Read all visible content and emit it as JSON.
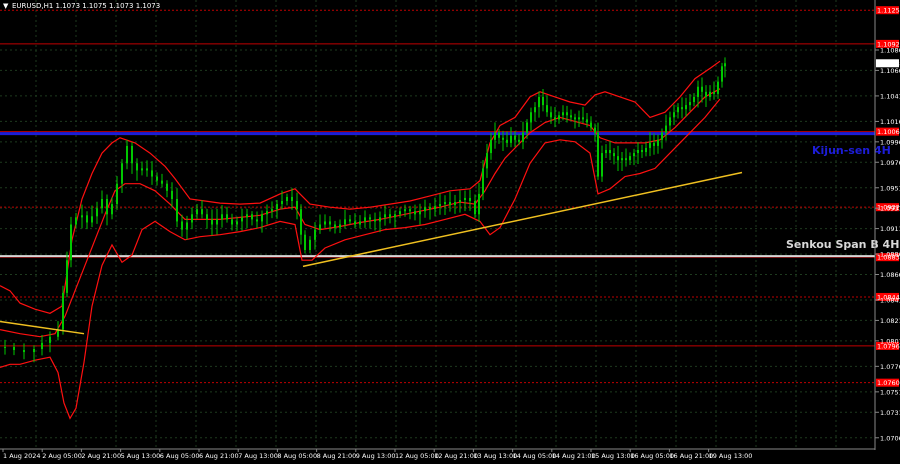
{
  "header": {
    "symbol_line": "EURUSD,H1  1.1073 1.1075 1.1073 1.1073",
    "arrow_glyph": "▼"
  },
  "labels": {
    "kijun": "Kijun-sen 4H",
    "senkou": "Senkou Span B 4H"
  },
  "colors": {
    "background": "#000000",
    "grid": "#1e3a1e",
    "candles": "#00c800",
    "bands": "#ff1010",
    "levels": "#c00000",
    "trendline": "#f0c020",
    "kijun": "#1d1dd8",
    "senkou": "#d8d8d8",
    "kijun_text": "#1d1dd8",
    "senkou_text": "#d8d8d8",
    "axis_text": "#ffffff",
    "highlight_box": "#ff0000"
  },
  "chart_data": {
    "type": "line",
    "title": "EURUSD,H1  1.1073 1.1075 1.1073 1.1073",
    "y_range": [
      1.0695,
      1.1135
    ],
    "price_ticks": [
      "1.1086",
      "1.1066",
      "1.1041",
      "1.1016",
      "1.0996",
      "1.0976",
      "1.0951",
      "1.0931",
      "1.0911",
      "1.0886",
      "1.0866",
      "1.0841",
      "1.0821",
      "1.0801",
      "1.0776",
      "1.0751",
      "1.0731",
      "1.0706"
    ],
    "time_ticks": [
      "1 Aug 2024",
      "2 Aug 05:00",
      "2 Aug 21:00",
      "5 Aug 13:00",
      "6 Aug 05:00",
      "6 Aug 21:00",
      "7 Aug 13:00",
      "8 Aug 05:00",
      "8 Aug 21:00",
      "9 Aug 13:00",
      "12 Aug 05:00",
      "12 Aug 21:00",
      "13 Aug 13:00",
      "14 Aug 05:00",
      "14 Aug 21:00",
      "15 Aug 13:00",
      "16 Aug 05:00",
      "16 Aug 21:00",
      "19 Aug 13:00"
    ],
    "levels": [
      {
        "value": 1.1125,
        "label": "1.1125",
        "style": "dotted"
      },
      {
        "value": 1.1092,
        "label": "1.1092",
        "style": "solid"
      },
      {
        "value": 1.1006,
        "label": "1.1006",
        "style": "solid"
      },
      {
        "value": 1.0932,
        "label": "1.0932",
        "style": "dotted"
      },
      {
        "value": 1.0883,
        "label": "1.0883",
        "style": "solid"
      },
      {
        "value": 1.0844,
        "label": "1.0844",
        "style": "dotted"
      },
      {
        "value": 1.0796,
        "label": "1.0796",
        "style": "solid"
      },
      {
        "value": 1.076,
        "label": "1.0760",
        "style": "dotted"
      }
    ],
    "kijun_sen": 1.1004,
    "senkou_span_b": 1.0884,
    "current_price": "1.1073",
    "trendlines": [
      {
        "x1": 0,
        "y1": 1.082,
        "x2": 84,
        "y2": 1.0808
      },
      {
        "x1": 303,
        "y1": 1.0874,
        "x2": 742,
        "y2": 1.0966
      }
    ],
    "price_series": [
      [
        5,
        1.0795
      ],
      [
        14,
        1.0792
      ],
      [
        24,
        1.079
      ],
      [
        34,
        1.0793
      ],
      [
        42,
        1.0799
      ],
      [
        50,
        1.0805
      ],
      [
        58,
        1.0812
      ],
      [
        63,
        1.0848
      ],
      [
        67,
        1.088
      ],
      [
        71,
        1.0915
      ],
      [
        76,
        1.0922
      ],
      [
        82,
        1.0924
      ],
      [
        87,
        1.0917
      ],
      [
        92,
        1.0923
      ],
      [
        97,
        1.0931
      ],
      [
        102,
        1.094
      ],
      [
        107,
        1.0925
      ],
      [
        112,
        1.0935
      ],
      [
        117,
        1.0955
      ],
      [
        122,
        1.0975
      ],
      [
        127,
        1.0992
      ],
      [
        132,
        1.0975
      ],
      [
        137,
        1.0968
      ],
      [
        142,
        1.097
      ],
      [
        147,
        1.0968
      ],
      [
        152,
        1.0962
      ],
      [
        157,
        1.0958
      ],
      [
        162,
        1.0955
      ],
      [
        167,
        1.0948
      ],
      [
        172,
        1.094
      ],
      [
        177,
        1.0918
      ],
      [
        182,
        1.091
      ],
      [
        187,
        1.0917
      ],
      [
        192,
        1.0925
      ],
      [
        197,
        1.093
      ],
      [
        202,
        1.0925
      ],
      [
        207,
        1.092
      ],
      [
        212,
        1.0915
      ],
      [
        217,
        1.092
      ],
      [
        222,
        1.0925
      ],
      [
        227,
        1.092
      ],
      [
        232,
        1.0915
      ],
      [
        237,
        1.0918
      ],
      [
        242,
        1.0922
      ],
      [
        247,
        1.0925
      ],
      [
        252,
        1.092
      ],
      [
        257,
        1.0918
      ],
      [
        262,
        1.0925
      ],
      [
        267,
        1.0928
      ],
      [
        272,
        1.093
      ],
      [
        277,
        1.0935
      ],
      [
        282,
        1.0938
      ],
      [
        287,
        1.0942
      ],
      [
        292,
        1.0938
      ],
      [
        297,
        1.093
      ],
      [
        301,
        1.0905
      ],
      [
        305,
        1.089
      ],
      [
        310,
        1.09
      ],
      [
        315,
        1.091
      ],
      [
        320,
        1.0915
      ],
      [
        325,
        1.0918
      ],
      [
        330,
        1.0915
      ],
      [
        335,
        1.0912
      ],
      [
        340,
        1.0915
      ],
      [
        345,
        1.092
      ],
      [
        350,
        1.0918
      ],
      [
        355,
        1.0915
      ],
      [
        360,
        1.0918
      ],
      [
        365,
        1.0922
      ],
      [
        370,
        1.092
      ],
      [
        375,
        1.0918
      ],
      [
        380,
        1.0922
      ],
      [
        385,
        1.0925
      ],
      [
        390,
        1.0922
      ],
      [
        395,
        1.0925
      ],
      [
        400,
        1.0928
      ],
      [
        405,
        1.093
      ],
      [
        410,
        1.0928
      ],
      [
        415,
        1.0925
      ],
      [
        420,
        1.0928
      ],
      [
        425,
        1.0932
      ],
      [
        430,
        1.093
      ],
      [
        435,
        1.0933
      ],
      [
        440,
        1.0935
      ],
      [
        445,
        1.0937
      ],
      [
        450,
        1.0934
      ],
      [
        455,
        1.0937
      ],
      [
        460,
        1.0939
      ],
      [
        465,
        1.0941
      ],
      [
        470,
        1.0938
      ],
      [
        475,
        1.0925
      ],
      [
        479,
        1.0945
      ],
      [
        483,
        1.097
      ],
      [
        487,
        1.0985
      ],
      [
        491,
        1.0998
      ],
      [
        495,
        1.1005
      ],
      [
        499,
        1.1
      ],
      [
        503,
        1.0998
      ],
      [
        507,
        1.0995
      ],
      [
        511,
        1.1002
      ],
      [
        515,
        1.0998
      ],
      [
        519,
        1.0996
      ],
      [
        523,
        1.1005
      ],
      [
        527,
        1.1015
      ],
      [
        531,
        1.1025
      ],
      [
        535,
        1.103
      ],
      [
        539,
        1.104
      ],
      [
        543,
        1.1032
      ],
      [
        547,
        1.1025
      ],
      [
        551,
        1.102
      ],
      [
        555,
        1.1018
      ],
      [
        559,
        1.1022
      ],
      [
        563,
        1.1025
      ],
      [
        567,
        1.1022
      ],
      [
        571,
        1.102
      ],
      [
        575,
        1.1018
      ],
      [
        579,
        1.102
      ],
      [
        583,
        1.1018
      ],
      [
        587,
        1.1015
      ],
      [
        591,
        1.101
      ],
      [
        595,
        1.1005
      ],
      [
        598,
        1.0962
      ],
      [
        602,
        1.0985
      ],
      [
        606,
        1.0988
      ],
      [
        610,
        1.0985
      ],
      [
        614,
        1.0982
      ],
      [
        618,
        1.0978
      ],
      [
        622,
        1.098
      ],
      [
        626,
        1.0978
      ],
      [
        630,
        1.0982
      ],
      [
        634,
        1.0985
      ],
      [
        638,
        1.0988
      ],
      [
        642,
        1.0986
      ],
      [
        646,
        1.099
      ],
      [
        650,
        1.0995
      ],
      [
        654,
        1.0992
      ],
      [
        658,
        1.0998
      ],
      [
        662,
        1.1005
      ],
      [
        666,
        1.1012
      ],
      [
        670,
        1.102
      ],
      [
        674,
        1.1025
      ],
      [
        678,
        1.103
      ],
      [
        682,
        1.1028
      ],
      [
        686,
        1.1032
      ],
      [
        690,
        1.1035
      ],
      [
        694,
        1.104
      ],
      [
        698,
        1.105
      ],
      [
        702,
        1.1045
      ],
      [
        706,
        1.104
      ],
      [
        710,
        1.1045
      ],
      [
        714,
        1.1043
      ],
      [
        718,
        1.1055
      ],
      [
        722,
        1.107
      ],
      [
        725,
        1.1073
      ]
    ],
    "bands": {
      "upper": [
        [
          0,
          1.0855
        ],
        [
          10,
          1.085
        ],
        [
          20,
          1.0838
        ],
        [
          35,
          1.0832
        ],
        [
          50,
          1.0828
        ],
        [
          62,
          1.0835
        ],
        [
          72,
          1.09
        ],
        [
          82,
          1.094
        ],
        [
          92,
          1.0965
        ],
        [
          102,
          1.0985
        ],
        [
          112,
          1.0995
        ],
        [
          120,
          1.1
        ],
        [
          135,
          1.0995
        ],
        [
          150,
          1.0985
        ],
        [
          165,
          1.0972
        ],
        [
          175,
          1.096
        ],
        [
          190,
          1.094
        ],
        [
          205,
          1.0938
        ],
        [
          220,
          1.0936
        ],
        [
          240,
          1.0935
        ],
        [
          260,
          1.0936
        ],
        [
          280,
          1.0945
        ],
        [
          295,
          1.095
        ],
        [
          300,
          1.0945
        ],
        [
          310,
          1.0935
        ],
        [
          330,
          1.0932
        ],
        [
          350,
          1.093
        ],
        [
          370,
          1.0932
        ],
        [
          390,
          1.0935
        ],
        [
          410,
          1.0938
        ],
        [
          430,
          1.0943
        ],
        [
          450,
          1.0948
        ],
        [
          470,
          1.095
        ],
        [
          480,
          1.0958
        ],
        [
          490,
          1.0995
        ],
        [
          500,
          1.1012
        ],
        [
          515,
          1.102
        ],
        [
          530,
          1.104
        ],
        [
          540,
          1.1045
        ],
        [
          555,
          1.104
        ],
        [
          570,
          1.1035
        ],
        [
          585,
          1.1032
        ],
        [
          595,
          1.1042
        ],
        [
          605,
          1.1045
        ],
        [
          620,
          1.104
        ],
        [
          635,
          1.1035
        ],
        [
          650,
          1.102
        ],
        [
          665,
          1.1025
        ],
        [
          680,
          1.104
        ],
        [
          695,
          1.1058
        ],
        [
          710,
          1.1068
        ],
        [
          720,
          1.1075
        ]
      ],
      "lower": [
        [
          0,
          1.0775
        ],
        [
          10,
          1.0778
        ],
        [
          20,
          1.0778
        ],
        [
          35,
          1.0782
        ],
        [
          50,
          1.0785
        ],
        [
          58,
          1.077
        ],
        [
          64,
          1.074
        ],
        [
          70,
          1.0725
        ],
        [
          76,
          1.0735
        ],
        [
          84,
          1.078
        ],
        [
          92,
          1.0835
        ],
        [
          102,
          1.0875
        ],
        [
          112,
          1.0895
        ],
        [
          122,
          1.0878
        ],
        [
          132,
          1.0885
        ],
        [
          142,
          1.091
        ],
        [
          155,
          1.0918
        ],
        [
          170,
          1.0908
        ],
        [
          185,
          1.09
        ],
        [
          200,
          1.0903
        ],
        [
          220,
          1.0905
        ],
        [
          240,
          1.0908
        ],
        [
          260,
          1.0912
        ],
        [
          280,
          1.0918
        ],
        [
          295,
          1.0915
        ],
        [
          302,
          1.088
        ],
        [
          312,
          1.088
        ],
        [
          325,
          1.0892
        ],
        [
          345,
          1.09
        ],
        [
          365,
          1.0905
        ],
        [
          385,
          1.091
        ],
        [
          405,
          1.0912
        ],
        [
          425,
          1.0915
        ],
        [
          445,
          1.092
        ],
        [
          465,
          1.0925
        ],
        [
          480,
          1.0918
        ],
        [
          490,
          1.0905
        ],
        [
          500,
          1.0912
        ],
        [
          515,
          1.094
        ],
        [
          530,
          1.0975
        ],
        [
          545,
          1.0995
        ],
        [
          560,
          1.0998
        ],
        [
          575,
          1.0996
        ],
        [
          590,
          1.0985
        ],
        [
          598,
          1.0945
        ],
        [
          610,
          1.095
        ],
        [
          625,
          1.0962
        ],
        [
          640,
          1.0965
        ],
        [
          655,
          1.097
        ],
        [
          670,
          1.0985
        ],
        [
          690,
          1.1005
        ],
        [
          705,
          1.102
        ],
        [
          720,
          1.1038
        ]
      ],
      "middle": [
        [
          0,
          1.0812
        ],
        [
          20,
          1.0808
        ],
        [
          40,
          1.0805
        ],
        [
          55,
          1.0808
        ],
        [
          65,
          1.0825
        ],
        [
          75,
          1.085
        ],
        [
          85,
          1.0875
        ],
        [
          95,
          1.09
        ],
        [
          105,
          1.0925
        ],
        [
          115,
          1.0948
        ],
        [
          125,
          1.0955
        ],
        [
          140,
          1.0955
        ],
        [
          155,
          1.0948
        ],
        [
          170,
          1.0935
        ],
        [
          185,
          1.092
        ],
        [
          200,
          1.092
        ],
        [
          220,
          1.092
        ],
        [
          240,
          1.0922
        ],
        [
          260,
          1.0924
        ],
        [
          280,
          1.093
        ],
        [
          295,
          1.0932
        ],
        [
          305,
          1.0915
        ],
        [
          320,
          1.091
        ],
        [
          340,
          1.0913
        ],
        [
          360,
          1.0917
        ],
        [
          380,
          1.092
        ],
        [
          400,
          1.0924
        ],
        [
          420,
          1.0928
        ],
        [
          440,
          1.0932
        ],
        [
          460,
          1.0937
        ],
        [
          475,
          1.0935
        ],
        [
          485,
          1.0948
        ],
        [
          495,
          1.0965
        ],
        [
          505,
          1.098
        ],
        [
          515,
          1.099
        ],
        [
          530,
          1.1005
        ],
        [
          545,
          1.1015
        ],
        [
          560,
          1.102
        ],
        [
          575,
          1.1016
        ],
        [
          590,
          1.1012
        ],
        [
          600,
          1.1
        ],
        [
          615,
          1.0995
        ],
        [
          630,
          1.0995
        ],
        [
          645,
          1.0995
        ],
        [
          660,
          1.0998
        ],
        [
          675,
          1.101
        ],
        [
          690,
          1.1025
        ],
        [
          705,
          1.104
        ],
        [
          720,
          1.1048
        ]
      ]
    }
  }
}
